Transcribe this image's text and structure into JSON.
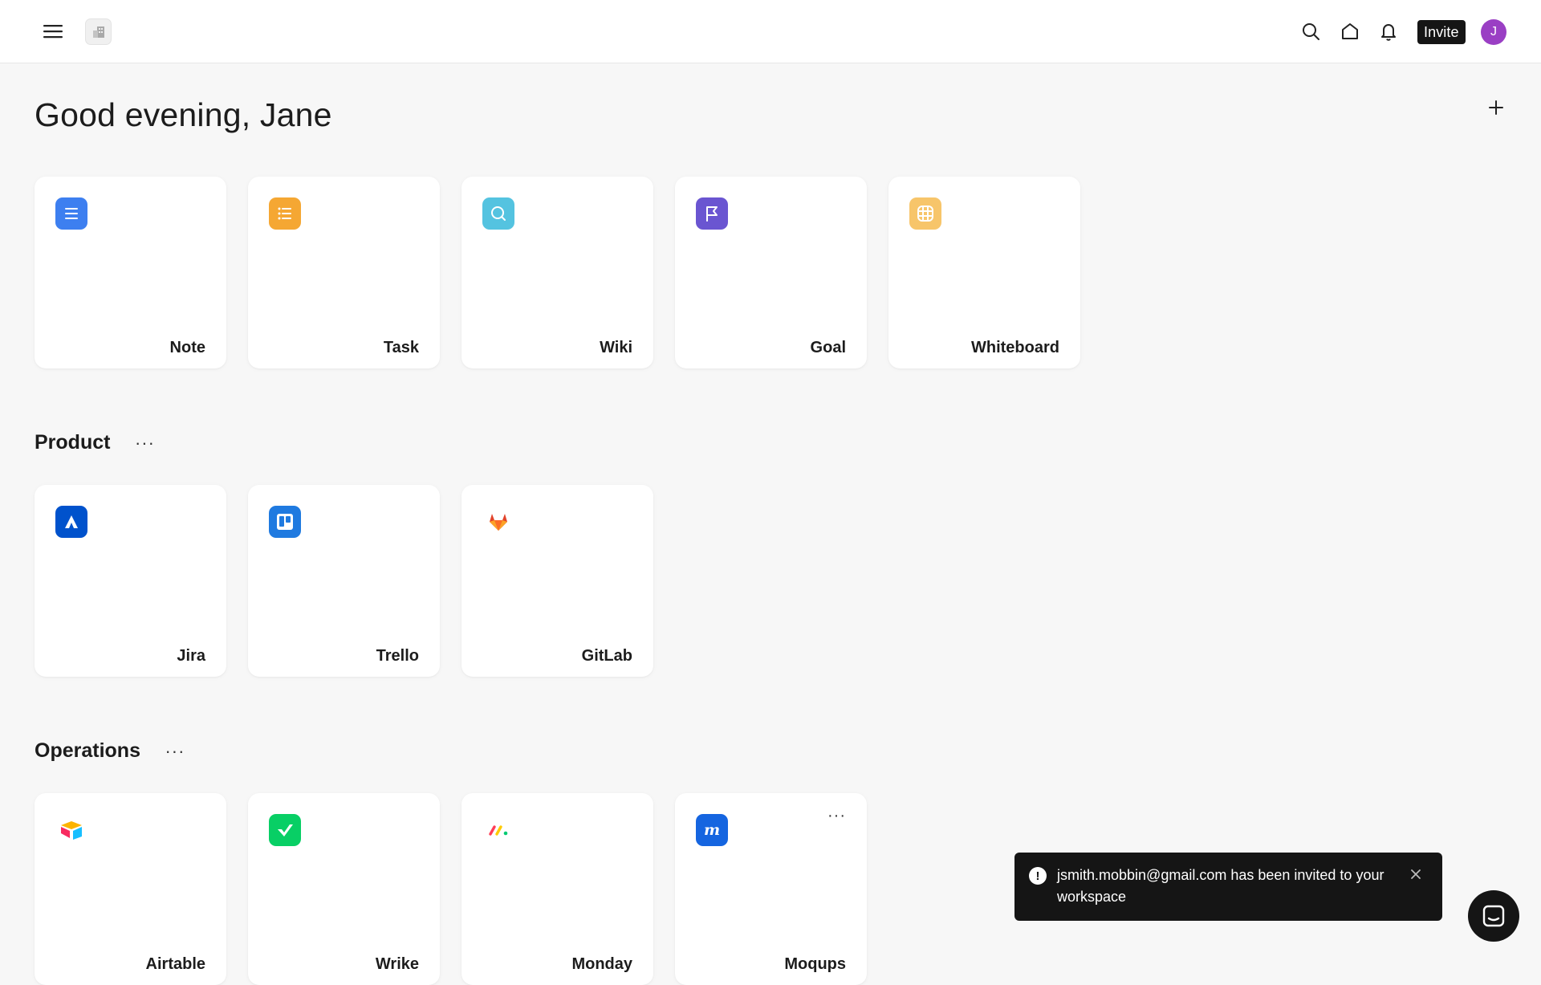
{
  "header": {
    "menu_icon": "hamburger-icon",
    "workspace_logo_icon": "building-icon",
    "search_icon": "search-icon",
    "home_icon": "home-icon",
    "notifications_icon": "bell-icon",
    "invite_label": "Invite",
    "avatar_initial": "J",
    "avatar_color": "#9a3fc4"
  },
  "greeting": "Good evening, Jane",
  "add_icon": "plus-icon",
  "quick_create": [
    {
      "label": "Note",
      "icon": "note-icon",
      "color": "#3d7ff0"
    },
    {
      "label": "Task",
      "icon": "task-list-icon",
      "color": "#f5a733"
    },
    {
      "label": "Wiki",
      "icon": "search-icon",
      "color": "#54c3e0"
    },
    {
      "label": "Goal",
      "icon": "flag-icon",
      "color": "#6a55d1"
    },
    {
      "label": "Whiteboard",
      "icon": "grid-icon",
      "color": "#f7c56a"
    }
  ],
  "sections": [
    {
      "title": "Product",
      "more": "···",
      "items": [
        {
          "label": "Jira",
          "icon": "jira-icon",
          "color": "#0052cc"
        },
        {
          "label": "Trello",
          "icon": "trello-icon",
          "color": "#1f7ae0"
        },
        {
          "label": "GitLab",
          "icon": "gitlab-icon",
          "color": "#e2432a"
        }
      ]
    },
    {
      "title": "Operations",
      "more": "···",
      "items": [
        {
          "label": "Airtable",
          "icon": "airtable-icon",
          "color": "#fcb400"
        },
        {
          "label": "Wrike",
          "icon": "wrike-icon",
          "color": "#08cf65"
        },
        {
          "label": "Monday",
          "icon": "monday-icon",
          "color": "#ff3d57"
        },
        {
          "label": "Moqups",
          "icon": "moqups-icon",
          "color": "#1565e0",
          "more": "···"
        }
      ]
    }
  ],
  "toast": {
    "icon": "alert-circle-icon",
    "message": "jsmith.mobbin@gmail.com has been invited to your workspace",
    "close_icon": "close-icon"
  },
  "chat_icon": "chat-icon"
}
